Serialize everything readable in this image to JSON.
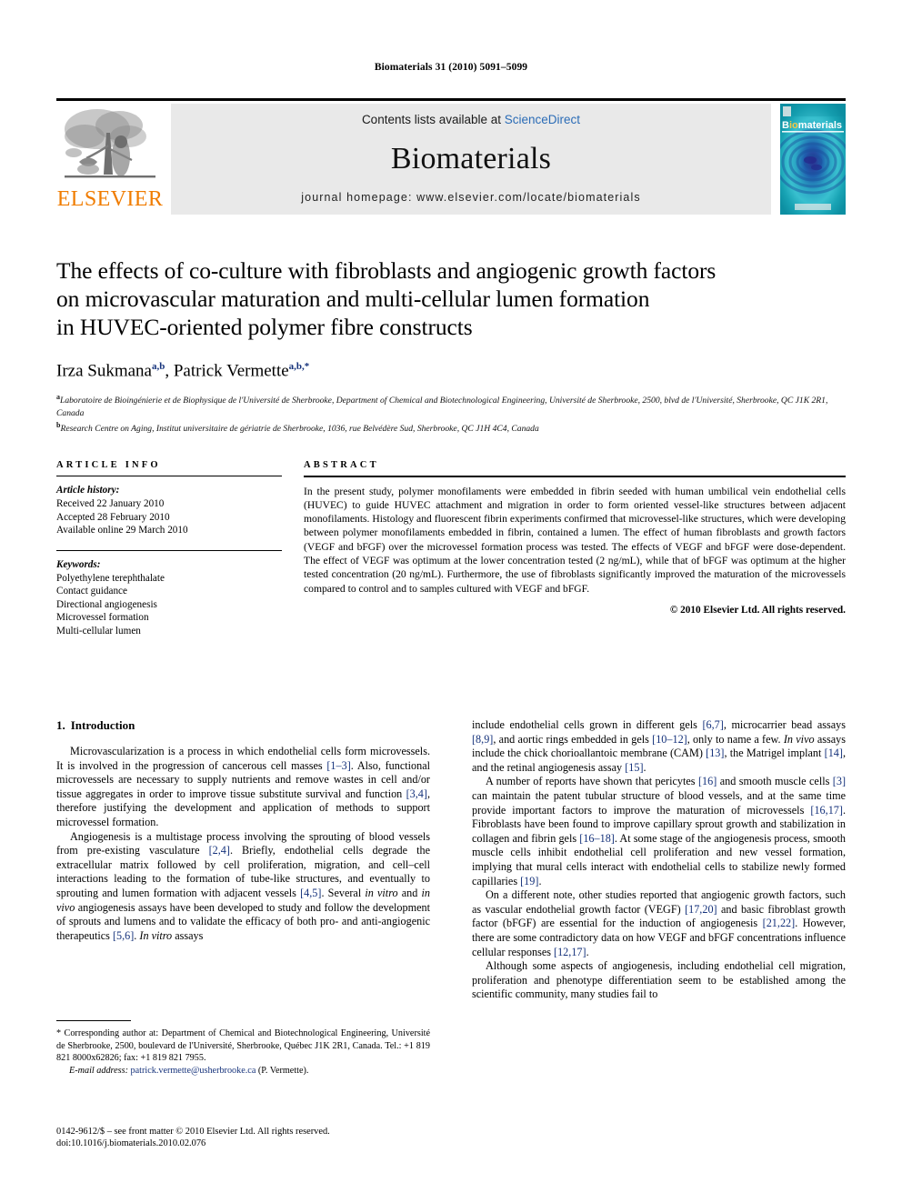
{
  "running_head": "Biomaterials 31 (2010) 5091–5099",
  "masthead": {
    "publisher_name": "ELSEVIER",
    "contents_prefix": "Contents lists available at ",
    "contents_link": "ScienceDirect",
    "journal_name": "Biomaterials",
    "homepage": "journal homepage: www.elsevier.com/locate/biomaterials",
    "cover_title": "Biomaterials",
    "colors": {
      "elsevier_orange": "#F07C00",
      "link_blue": "#2B6CB6",
      "band_grey": "#E9E9E9",
      "cover_teal": "#0e8ea0",
      "reference_blue": "#15327B"
    }
  },
  "article": {
    "title_lines": [
      "The effects of co-culture with fibroblasts and angiogenic growth factors",
      "on microvascular maturation and multi-cellular lumen formation",
      "in HUVEC-oriented polymer fibre constructs"
    ],
    "authors": [
      {
        "name": "Irza Sukmana",
        "marks": "a,b",
        "sep": ", "
      },
      {
        "name": "Patrick Vermette",
        "marks": "a,b,*",
        "sep": ""
      }
    ],
    "affiliations": [
      {
        "mark": "a",
        "text": "Laboratoire de Bioingénierie et de Biophysique de l'Université de Sherbrooke, Department of Chemical and Biotechnological Engineering, Université de Sherbrooke, 2500, blvd de l'Université, Sherbrooke, QC J1K 2R1, Canada"
      },
      {
        "mark": "b",
        "text": "Research Centre on Aging, Institut universitaire de gériatrie de Sherbrooke, 1036, rue Belvédère Sud, Sherbrooke, QC J1H 4C4, Canada"
      }
    ]
  },
  "article_info": {
    "heading": "ARTICLE INFO",
    "history_label": "Article history:",
    "history": [
      "Received 22 January 2010",
      "Accepted 28 February 2010",
      "Available online 29 March 2010"
    ],
    "keywords_label": "Keywords:",
    "keywords": [
      "Polyethylene terephthalate",
      "Contact guidance",
      "Directional angiogenesis",
      "Microvessel formation",
      "Multi-cellular lumen"
    ]
  },
  "abstract": {
    "heading": "ABSTRACT",
    "text": "In the present study, polymer monofilaments were embedded in fibrin seeded with human umbilical vein endothelial cells (HUVEC) to guide HUVEC attachment and migration in order to form oriented vessel-like structures between adjacent monofilaments. Histology and fluorescent fibrin experiments confirmed that microvessel-like structures, which were developing between polymer monofilaments embedded in fibrin, contained a lumen. The effect of human fibroblasts and growth factors (VEGF and bFGF) over the microvessel formation process was tested. The effects of VEGF and bFGF were dose-dependent. The effect of VEGF was optimum at the lower concentration tested (2 ng/mL), while that of bFGF was optimum at the higher tested concentration (20 ng/mL). Furthermore, the use of fibroblasts significantly improved the maturation of the microvessels compared to control and to samples cultured with VEGF and bFGF.",
    "copyright": "© 2010 Elsevier Ltd. All rights reserved."
  },
  "introduction": {
    "number": "1.",
    "heading": "Introduction",
    "left_paragraphs": [
      "Microvascularization is a process in which endothelial cells form microvessels. It is involved in the progression of cancerous cell masses [1–3]. Also, functional microvessels are necessary to supply nutrients and remove wastes in cell and/or tissue aggregates in order to improve tissue substitute survival and function [3,4], therefore justifying the development and application of methods to support microvessel formation.",
      "Angiogenesis is a multistage process involving the sprouting of blood vessels from pre-existing vasculature [2,4]. Briefly, endothelial cells degrade the extracellular matrix followed by cell proliferation, migration, and cell–cell interactions leading to the formation of tube-like structures, and eventually to sprouting and lumen formation with adjacent vessels [4,5]. Several in vitro and in vivo angiogenesis assays have been developed to study and follow the development of sprouts and lumens and to validate the efficacy of both pro- and anti-angiogenic therapeutics [5,6]. In vitro assays"
    ],
    "right_paragraphs": [
      "include endothelial cells grown in different gels [6,7], microcarrier bead assays [8,9], and aortic rings embedded in gels [10–12], only to name a few. In vivo assays include the chick chorioallantoic membrane (CAM) [13], the Matrigel implant [14], and the retinal angiogenesis assay [15].",
      "A number of reports have shown that pericytes [16] and smooth muscle cells [3] can maintain the patent tubular structure of blood vessels, and at the same time provide important factors to improve the maturation of microvessels [16,17]. Fibroblasts have been found to improve capillary sprout growth and stabilization in collagen and fibrin gels [16–18]. At some stage of the angiogenesis process, smooth muscle cells inhibit endothelial cell proliferation and new vessel formation, implying that mural cells interact with endothelial cells to stabilize newly formed capillaries [19].",
      "On a different note, other studies reported that angiogenic growth factors, such as vascular endothelial growth factor (VEGF) [17,20] and basic fibroblast growth factor (bFGF) are essential for the induction of angiogenesis [21,22]. However, there are some contradictory data on how VEGF and bFGF concentrations influence cellular responses [12,17].",
      "Although some aspects of angiogenesis, including endothelial cell migration, proliferation and phenotype differentiation seem to be established among the scientific community, many studies fail to"
    ]
  },
  "footnote": {
    "corresponding": "* Corresponding author at: Department of Chemical and Biotechnological Engineering, Université de Sherbrooke, 2500, boulevard de l'Université, Sherbrooke, Québec J1K 2R1, Canada. Tel.: +1 819 821 8000x62826; fax: +1 819 821 7955.",
    "email_label": "E-mail address:",
    "email_address": "patrick.vermette@usherbrooke.ca",
    "email_suffix": " (P. Vermette)."
  },
  "imprint": {
    "line1": "0142-9612/$ – see front matter © 2010 Elsevier Ltd. All rights reserved.",
    "line2": "doi:10.1016/j.biomaterials.2010.02.076"
  }
}
